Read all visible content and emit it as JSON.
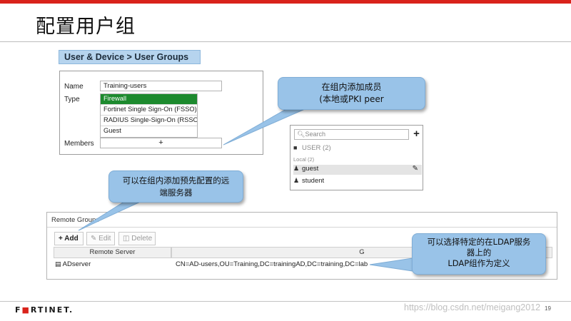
{
  "slide": {
    "title": "配置用户组",
    "breadcrumb": "User & Device > User Groups",
    "page_number": "19",
    "watermark": "https://blog.csdn.net/meigang2012",
    "logo": {
      "prefix": "F",
      "red": "■",
      "suffix": "RTINET."
    }
  },
  "form": {
    "name_label": "Name",
    "name_value": "Training-users",
    "type_label": "Type",
    "type_options": [
      "Firewall",
      "Fortinet Single Sign-On (FSSO)",
      "RADIUS Single-Sign-On (RSSO)",
      "Guest"
    ],
    "type_selected": "Firewall",
    "members_label": "Members",
    "members_add": "+"
  },
  "callouts": {
    "add_members": {
      "line1": "在组内添加成员",
      "line2": "(本地或PKI peer"
    },
    "remote_servers": {
      "line1": "可以在组内添加预先配置的远",
      "line2": "端服务器"
    },
    "ldap": {
      "line1": "可以选择特定的在LDAP服务",
      "line2": "器上的",
      "line3": "LDAP组作为定义"
    }
  },
  "picker": {
    "search_placeholder": "Search",
    "add": "+",
    "group_label": "USER (2)",
    "sub_label": "Local (2)",
    "users": [
      "guest",
      "student"
    ]
  },
  "remote_groups": {
    "title": "Remote Groups",
    "buttons": {
      "add": "Add",
      "edit": "Edit",
      "delete": "Delete"
    },
    "columns": [
      "Remote Server",
      "G"
    ],
    "rows": [
      {
        "server": "ADserver",
        "group": "CN=AD-users,OU=Training,DC=trainingAD,DC=training,DC=lab"
      }
    ]
  },
  "colors": {
    "selected_type": "#1d8a2e",
    "callout": "#99c3e8",
    "accent_red": "#d9231b",
    "breadcrumb_bg": "#b6d4ee"
  }
}
